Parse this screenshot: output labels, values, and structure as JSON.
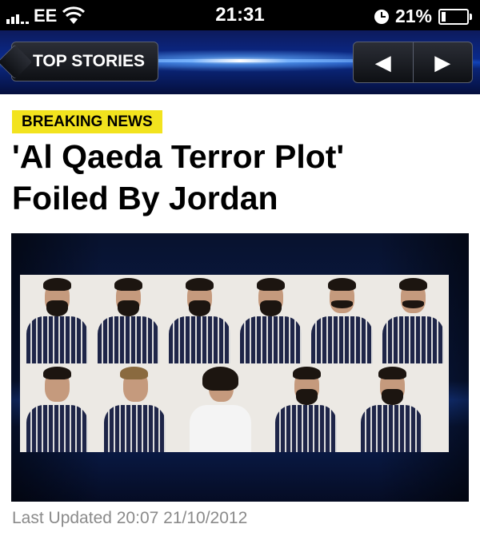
{
  "status_bar": {
    "carrier": "EE",
    "time": "21:31",
    "battery_percent": "21%",
    "battery_level": 0.21
  },
  "nav": {
    "back_label": "TOP STORIES",
    "prev_icon": "triangle-left",
    "next_icon": "triangle-right",
    "prev_glyph": "◀",
    "next_glyph": "▶"
  },
  "article": {
    "badge": "BREAKING NEWS",
    "headline_line1": "'Al Qaeda Terror Plot'",
    "headline_line2": "Foiled By Jordan",
    "last_updated": "Last Updated 20:07 21/10/2012"
  },
  "colors": {
    "badge_bg": "#f2e31e",
    "nav_blue": "#0a2a8c",
    "updated_text": "#8a8a8a"
  }
}
